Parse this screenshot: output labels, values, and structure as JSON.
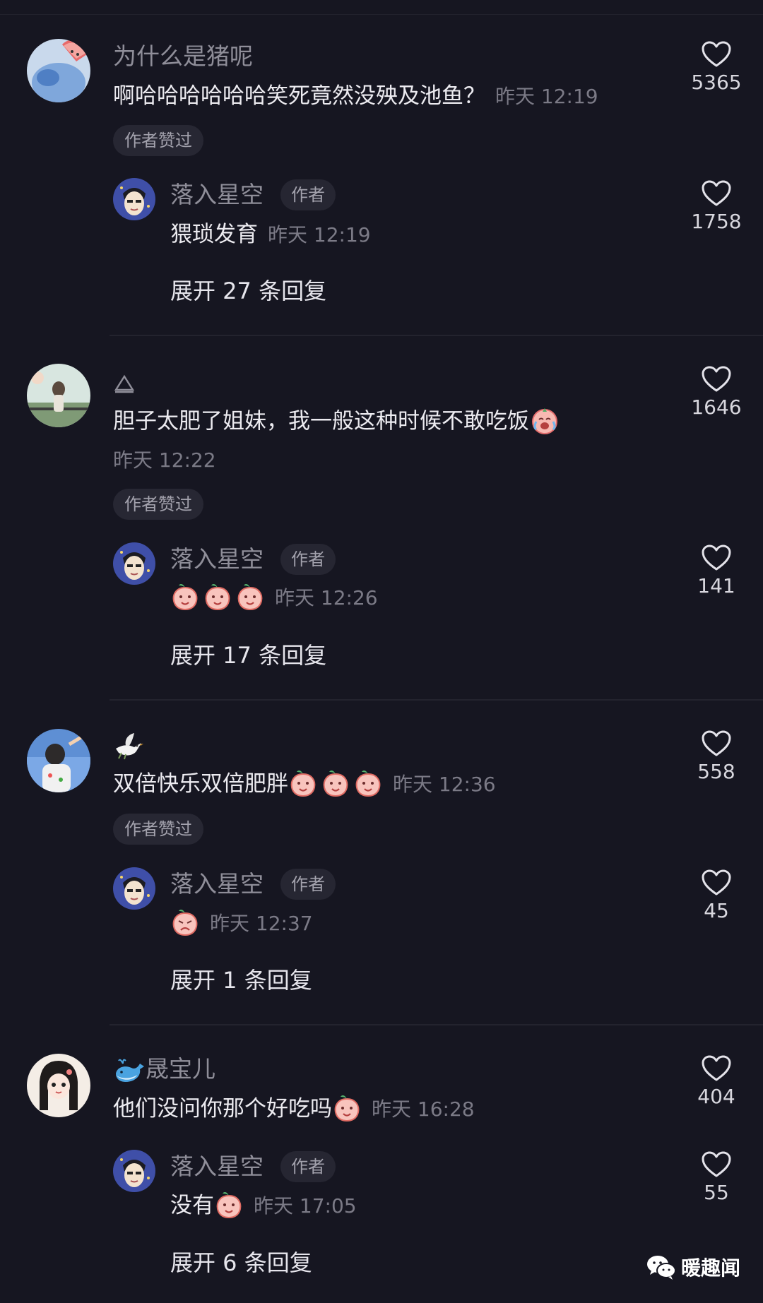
{
  "comments": [
    {
      "name": "为什么是猪呢",
      "text": "啊哈哈哈哈哈哈笑死竟然没殃及池鱼？",
      "time": "昨天 12:19",
      "likes": "5365",
      "badge": "作者赞过",
      "reply": {
        "name": "落入星空",
        "tag": "作者",
        "text": "猥琐发育",
        "time": "昨天 12:19",
        "likes": "1758"
      },
      "expand": "展开 27 条回复"
    },
    {
      "name": "",
      "name_icon": "delta-glyph-icon",
      "text": "胆子太肥了姐妹，我一般这种时候不敢吃饭",
      "time": "昨天 12:22",
      "likes": "1646",
      "badge": "作者赞过",
      "reply": {
        "name": "落入星空",
        "tag": "作者",
        "text": "",
        "time": "昨天 12:26",
        "likes": "141"
      },
      "expand": "展开 17 条回复"
    },
    {
      "name": "",
      "name_icon": "dove-icon",
      "text": "双倍快乐双倍肥胖",
      "time": "昨天 12:36",
      "likes": "558",
      "badge": "作者赞过",
      "reply": {
        "name": "落入星空",
        "tag": "作者",
        "text": "",
        "time": "昨天 12:37",
        "likes": "45"
      },
      "expand": "展开 1 条回复"
    },
    {
      "name": "晟宝儿",
      "name_icon": "whale-icon",
      "text": "他们没问你那个好吃吗",
      "time": "昨天 16:28",
      "likes": "404",
      "reply": {
        "name": "落入星空",
        "tag": "作者",
        "text": "没有",
        "time": "昨天 17:05",
        "likes": "55"
      },
      "expand": "展开 6 条回复"
    }
  ],
  "watermark": {
    "text": "暖趣闻",
    "icon": "wechat-icon"
  },
  "colors": {
    "background": "#161621",
    "primary_text": "#ecebf0",
    "secondary_text": "#8f8e99",
    "badge_bg": "#272733"
  }
}
